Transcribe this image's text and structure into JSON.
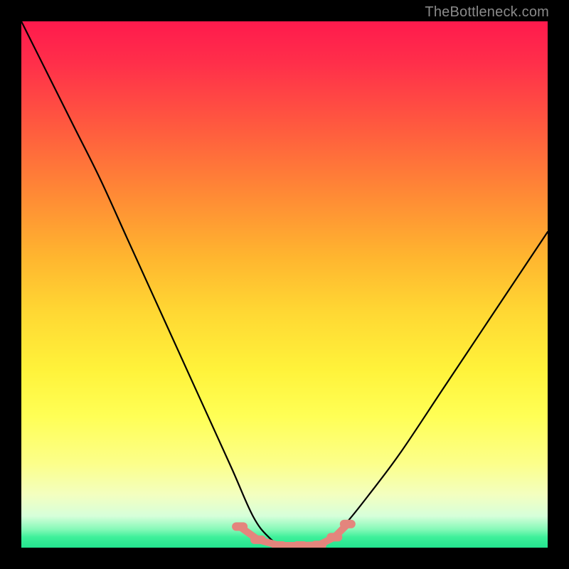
{
  "watermark": "TheBottleneck.com",
  "chart_data": {
    "type": "line",
    "title": "",
    "xlabel": "",
    "ylabel": "",
    "xlim": [
      0,
      100
    ],
    "ylim": [
      0,
      100
    ],
    "grid": false,
    "legend": false,
    "background": "red-yellow-green vertical gradient (red top, green bottom)",
    "series": [
      {
        "name": "bottleneck-curve",
        "color": "#000000",
        "x": [
          0,
          5,
          10,
          15,
          20,
          25,
          30,
          35,
          40,
          44,
          47,
          50,
          53,
          56,
          59,
          62,
          66,
          72,
          80,
          88,
          96,
          100
        ],
        "values": [
          100,
          90,
          80,
          70,
          59,
          48,
          37,
          26,
          15,
          6,
          2,
          0,
          0,
          0,
          2,
          5,
          10,
          18,
          30,
          42,
          54,
          60
        ]
      }
    ],
    "markers": {
      "name": "bottom-nodes",
      "color": "#e4857d",
      "type": "rounded-capsule",
      "x": [
        41.5,
        45.0,
        49.0,
        53.0,
        56.5,
        59.5,
        62.0
      ],
      "values": [
        4.0,
        1.5,
        0.4,
        0.4,
        0.5,
        2.0,
        4.5
      ]
    }
  }
}
